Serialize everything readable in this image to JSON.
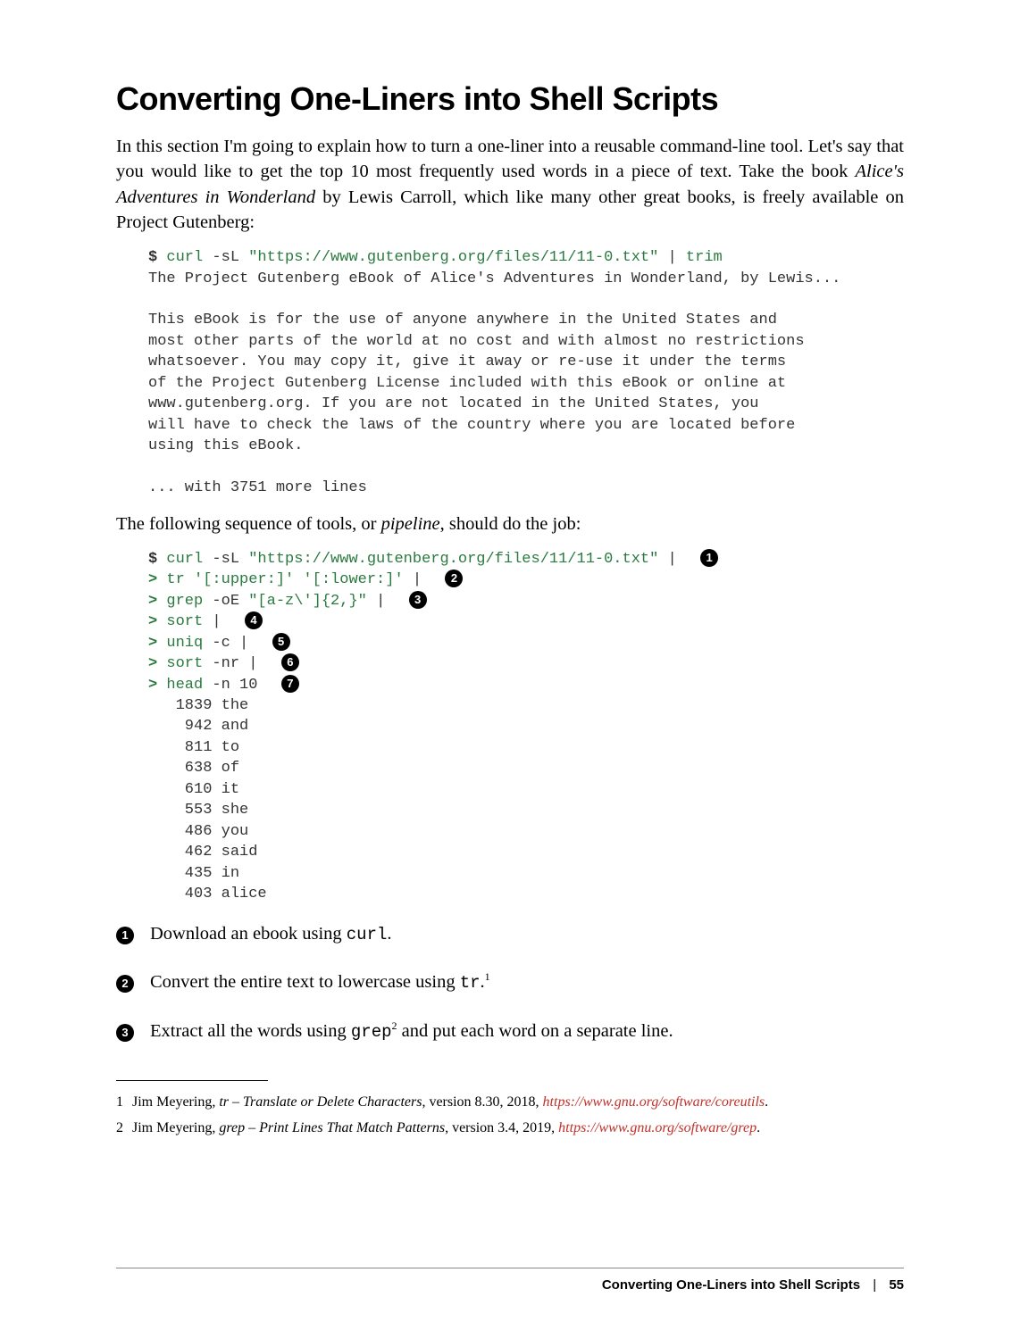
{
  "heading": "Converting One-Liners into Shell Scripts",
  "intro": {
    "p1_a": "In this section I'm going to explain how to turn a one-liner into a reusable command-line tool. Let's say that you would like to get the top 10 most frequently used words in a piece of text. Take the book ",
    "p1_book": "Alice's Adventures in Wonderland",
    "p1_b": " by Lewis Carroll, which like many other great books, is freely available on Project Gutenberg:"
  },
  "code1": {
    "prompt": "$",
    "curl": "curl",
    "curl_args": "-sL",
    "url": "\"https://www.gutenberg.org/files/11/11-0.txt\"",
    "pipe": "|",
    "trim": "trim",
    "out1": "The Project Gutenberg eBook of Alice's Adventures in Wonderland, by Lewis...",
    "blank": "",
    "out2": "This eBook is for the use of anyone anywhere in the United States and",
    "out3": "most other parts of the world at no cost and with almost no restrictions",
    "out4": "whatsoever. You may copy it, give it away or re-use it under the terms",
    "out5": "of the Project Gutenberg License included with this eBook or online at",
    "out6": "www.gutenberg.org. If you are not located in the United States, you",
    "out7": "will have to check the laws of the country where you are located before",
    "out8": "using this eBook.",
    "out9": "... with 3751 more lines"
  },
  "mid": {
    "p_a": "The following sequence of tools, or ",
    "p_i": "pipeline",
    "p_b": ", should do the job:"
  },
  "code2": {
    "prompt": "$",
    "cont": ">",
    "l1_cmd": "curl",
    "l1_args": "-sL",
    "l1_url": "\"https://www.gutenberg.org/files/11/11-0.txt\"",
    "l1_tail": "|",
    "l2_cmd": "tr",
    "l2_a": "'[:upper:]' '[:lower:]'",
    "l2_tail": "|",
    "l3_cmd": "grep",
    "l3_a": "-oE",
    "l3_q": "\"[a-z\\']{2,}\"",
    "l3_tail": "|",
    "l4_cmd": "sort",
    "l4_tail": "|",
    "l5_cmd": "uniq",
    "l5_a": "-c",
    "l5_tail": "|",
    "l6_cmd": "sort",
    "l6_a": "-nr",
    "l6_tail": "|",
    "l7_cmd": "head",
    "l7_a": "-n 10",
    "o1": "   1839 the",
    "o2": "    942 and",
    "o3": "    811 to",
    "o4": "    638 of",
    "o5": "    610 it",
    "o6": "    553 she",
    "o7": "    486 you",
    "o8": "    462 said",
    "o9": "    435 in",
    "o10": "    403 alice"
  },
  "callouts": {
    "n1": "1",
    "n2": "2",
    "n3": "3",
    "n4": "4",
    "n5": "5",
    "n6": "6",
    "n7": "7",
    "i1_a": "Download an ebook using ",
    "i1_code": "curl",
    "i1_b": ".",
    "i2_a": "Convert the entire text to lowercase using ",
    "i2_code": "tr",
    "i2_b": ".",
    "i2_sup": "1",
    "i3_a": "Extract all the words using ",
    "i3_code": "grep",
    "i3_sup": "2",
    "i3_b": " and put each word on a separate line."
  },
  "footnotes": {
    "f1_num": "1",
    "f1_author": "Jim Meyering, ",
    "f1_title": "tr – Translate or Delete Characters",
    "f1_mid": ", version 8.30, 2018, ",
    "f1_link": "https://www.gnu.org/software/coreutils",
    "f1_end": ".",
    "f2_num": "2",
    "f2_author": "Jim Meyering, ",
    "f2_title": "grep – Print Lines That Match Patterns",
    "f2_mid": ", version 3.4, 2019, ",
    "f2_link": "https://www.gnu.org/software/grep",
    "f2_end": "."
  },
  "footer": {
    "title": "Converting One-Liners into Shell Scripts",
    "sep": "|",
    "page": "55"
  }
}
